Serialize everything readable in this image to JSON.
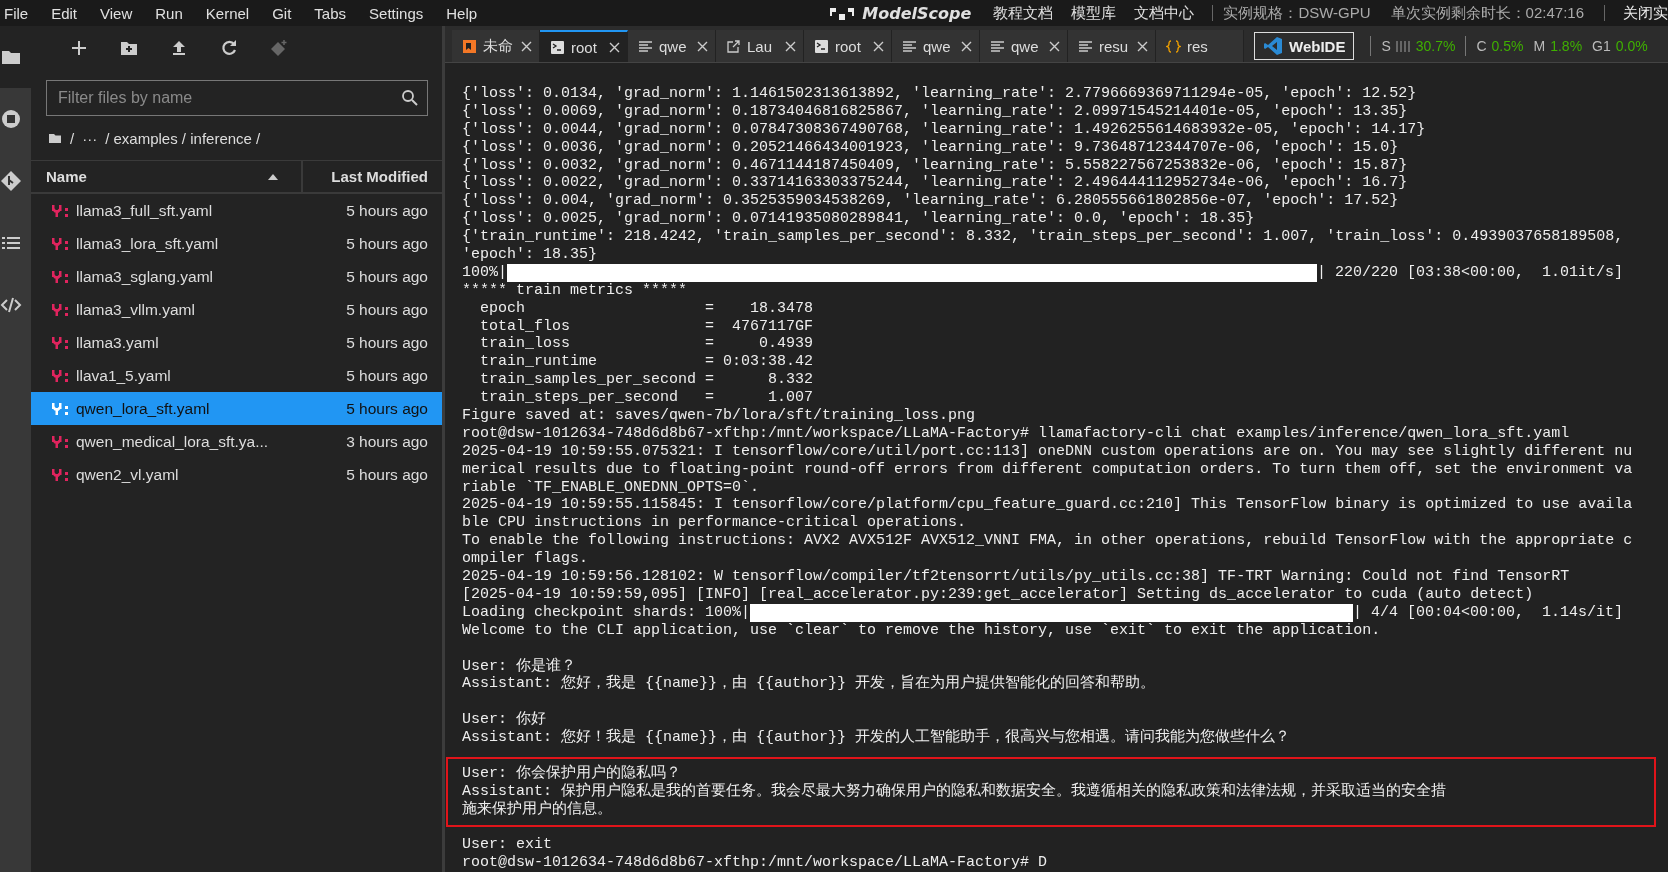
{
  "menu_bar": {
    "items": [
      "File",
      "Edit",
      "View",
      "Run",
      "Kernel",
      "Git",
      "Tabs",
      "Settings",
      "Help"
    ],
    "brand": "ModelScope",
    "links": [
      "教程文档",
      "模型库",
      "文档中心"
    ],
    "instance_spec": "实例规格：DSW-GPU",
    "remaining_time": "单次实例剩余时长：02:47:16",
    "close_button": "关闭实"
  },
  "activity_bar": {
    "items": [
      {
        "kind": "folder",
        "selected": true
      },
      {
        "kind": "running",
        "selected": false
      },
      {
        "kind": "git",
        "selected": false
      },
      {
        "kind": "toc",
        "selected": false
      },
      {
        "kind": "code",
        "selected": false
      }
    ]
  },
  "file_browser": {
    "toolbar": [
      {
        "kind": "new-file",
        "disabled": false
      },
      {
        "kind": "new-folder",
        "disabled": false
      },
      {
        "kind": "upload",
        "disabled": false
      },
      {
        "kind": "refresh",
        "disabled": false
      },
      {
        "kind": "git-clone",
        "disabled": true
      }
    ],
    "filter": {
      "placeholder": "Filter files by name"
    },
    "breadcrumb": [
      "/",
      "···",
      "/ examples / inference /"
    ],
    "columns": [
      {
        "label": "Name",
        "sorted": true
      },
      {
        "label": "Last Modified",
        "sorted": false
      }
    ],
    "files": [
      {
        "name": "llama3_full_sft.yaml",
        "modified": "5 hours ago",
        "selected": false
      },
      {
        "name": "llama3_lora_sft.yaml",
        "modified": "5 hours ago",
        "selected": false
      },
      {
        "name": "llama3_sglang.yaml",
        "modified": "5 hours ago",
        "selected": false
      },
      {
        "name": "llama3_vllm.yaml",
        "modified": "5 hours ago",
        "selected": false
      },
      {
        "name": "llama3.yaml",
        "modified": "5 hours ago",
        "selected": false
      },
      {
        "name": "llava1_5.yaml",
        "modified": "5 hours ago",
        "selected": false
      },
      {
        "name": "qwen_lora_sft.yaml",
        "modified": "5 hours ago",
        "selected": true
      },
      {
        "name": "qwen_medical_lora_sft.ya...",
        "modified": "3 hours ago",
        "selected": false
      },
      {
        "name": "qwen2_vl.yaml",
        "modified": "5 hours ago",
        "selected": false
      }
    ]
  },
  "tabs": [
    {
      "label": "未命",
      "kind": "notebook",
      "selected": false,
      "closable": true
    },
    {
      "label": "root",
      "kind": "terminal",
      "selected": true,
      "closable": true
    },
    {
      "label": "qwe",
      "kind": "text",
      "selected": false,
      "closable": true
    },
    {
      "label": "Lau",
      "kind": "launcher",
      "selected": false,
      "closable": true
    },
    {
      "label": "root",
      "kind": "terminal",
      "selected": false,
      "closable": true
    },
    {
      "label": "qwe",
      "kind": "text",
      "selected": false,
      "closable": true
    },
    {
      "label": "qwe",
      "kind": "text",
      "selected": false,
      "closable": true
    },
    {
      "label": "resu",
      "kind": "text",
      "selected": false,
      "closable": true
    },
    {
      "label": "res",
      "kind": "json",
      "selected": false,
      "closable": false
    }
  ],
  "status": {
    "webide_button": "WebIDE",
    "metrics": [
      {
        "label": "S",
        "value": "30.7%",
        "kind": "bars"
      },
      {
        "label": "C",
        "value": "0.5%",
        "kind": "plain"
      },
      {
        "label": "M",
        "value": "1.8%",
        "kind": "plain"
      },
      {
        "label": "G1",
        "value": "0.0%",
        "kind": "plain"
      }
    ]
  },
  "terminal": {
    "lines": [
      {
        "kind": "text",
        "text": "{'loss': 0.0134, 'grad_norm': 1.1461502313613892, 'learning_rate': 2.7796669369711294e-05, 'epoch': 12.52}"
      },
      {
        "kind": "text",
        "text": "{'loss': 0.0069, 'grad_norm': 0.18734046816825867, 'learning_rate': 2.09971545214401e-05, 'epoch': 13.35}"
      },
      {
        "kind": "text",
        "text": "{'loss': 0.0044, 'grad_norm': 0.07847308367490768, 'learning_rate': 1.4926255614683932e-05, 'epoch': 14.17}"
      },
      {
        "kind": "text",
        "text": "{'loss': 0.0036, 'grad_norm': 0.20521466434001923, 'learning_rate': 9.73648712344707e-06, 'epoch': 15.0}"
      },
      {
        "kind": "text",
        "text": "{'loss': 0.0032, 'grad_norm': 0.4671144187450409, 'learning_rate': 5.558227567253832e-06, 'epoch': 15.87}"
      },
      {
        "kind": "text",
        "text": "{'loss': 0.0022, 'grad_norm': 0.33714163303375244, 'learning_rate': 2.496444112952734e-06, 'epoch': 16.7}"
      },
      {
        "kind": "text",
        "text": "{'loss': 0.004, 'grad_norm': 0.3525359034538269, 'learning_rate': 6.280555661802856e-07, 'epoch': 17.52}"
      },
      {
        "kind": "text",
        "text": "{'loss': 0.0025, 'grad_norm': 0.07141935080289841, 'learning_rate': 0.0, 'epoch': 18.35}"
      },
      {
        "kind": "text",
        "text": "{'train_runtime': 218.4242, 'train_samples_per_second': 8.332, 'train_steps_per_second': 1.007, 'train_loss': 0.4939037658189508,"
      },
      {
        "kind": "text",
        "text": "'epoch': 18.35}"
      },
      {
        "kind": "progress",
        "prefix": "100%|",
        "suffix": "| 220/220 [03:38<00:00,  1.01it/s]",
        "level": 1
      },
      {
        "kind": "text",
        "text": "***** train metrics *****"
      },
      {
        "kind": "text",
        "text": "  epoch                    =    18.3478"
      },
      {
        "kind": "text",
        "text": "  total_flos               =  4767117GF"
      },
      {
        "kind": "text",
        "text": "  train_loss               =     0.4939"
      },
      {
        "kind": "text",
        "text": "  train_runtime            = 0:03:38.42"
      },
      {
        "kind": "text",
        "text": "  train_samples_per_second =      8.332"
      },
      {
        "kind": "text",
        "text": "  train_steps_per_second   =      1.007"
      },
      {
        "kind": "text",
        "text": "Figure saved at: saves/qwen-7b/lora/sft/training_loss.png"
      },
      {
        "kind": "text",
        "text": "root@dsw-1012634-748d6d8b67-xfthp:/mnt/workspace/LLaMA-Factory# llamafactory-cli chat examples/inference/qwen_lora_sft.yaml"
      },
      {
        "kind": "text",
        "text": "2025-04-19 10:59:55.075321: I tensorflow/core/util/port.cc:113] oneDNN custom operations are on. You may see slightly different nu"
      },
      {
        "kind": "text",
        "text": "merical results due to floating-point round-off errors from different computation orders. To turn them off, set the environment va"
      },
      {
        "kind": "text",
        "text": "riable `TF_ENABLE_ONEDNN_OPTS=0`."
      },
      {
        "kind": "text",
        "text": "2025-04-19 10:59:55.115845: I tensorflow/core/platform/cpu_feature_guard.cc:210] This TensorFlow binary is optimized to use availa"
      },
      {
        "kind": "text",
        "text": "ble CPU instructions in performance-critical operations."
      },
      {
        "kind": "text",
        "text": "To enable the following instructions: AVX2 AVX512F AVX512_VNNI FMA, in other operations, rebuild TensorFlow with the appropriate c"
      },
      {
        "kind": "text",
        "text": "ompiler flags."
      },
      {
        "kind": "text",
        "text": "2025-04-19 10:59:56.128102: W tensorflow/compiler/tf2tensorrt/utils/py_utils.cc:38] TF-TRT Warning: Could not find TensorRT"
      },
      {
        "kind": "text",
        "text": "[2025-04-19 10:59:59,095] [INFO] [real_accelerator.py:239:get_accelerator] Setting ds_accelerator to cuda (auto detect)"
      },
      {
        "kind": "progress",
        "prefix": "Loading checkpoint shards: 100%|",
        "suffix": "| 4/4 [00:04<00:00,  1.14s/it]",
        "level": 1
      },
      {
        "kind": "text",
        "text": "Welcome to the CLI application, use `clear` to remove the history, use `exit` to exit the application."
      },
      {
        "kind": "blank"
      },
      {
        "kind": "text",
        "text": "User: 你是谁？"
      },
      {
        "kind": "text",
        "text": "Assistant: 您好，我是 {{name}}，由 {{author}} 开发，旨在为用户提供智能化的回答和帮助。"
      },
      {
        "kind": "blank"
      },
      {
        "kind": "text",
        "text": "User: 你好"
      },
      {
        "kind": "text",
        "text": "Assistant: 您好！我是 {{name}}，由 {{author}} 开发的人工智能助手，很高兴与您相遇。请问我能为您做些什么？"
      },
      {
        "kind": "blank"
      },
      {
        "kind": "highlight",
        "lines": [
          "User: 你会保护用户的隐私吗？",
          "Assistant: 保护用户隐私是我的首要任务。我会尽最大努力确保用户的隐私和数据安全。我遵循相关的隐私政策和法律法规，并采取适当的安全措",
          "施来保护用户的信息。"
        ]
      },
      {
        "kind": "blank"
      },
      {
        "kind": "text",
        "text": "User: exit"
      },
      {
        "kind": "text",
        "text": "root@dsw-1012634-748d6d8b67-xfthp:/mnt/workspace/LLaMA-Factory# D"
      }
    ]
  }
}
